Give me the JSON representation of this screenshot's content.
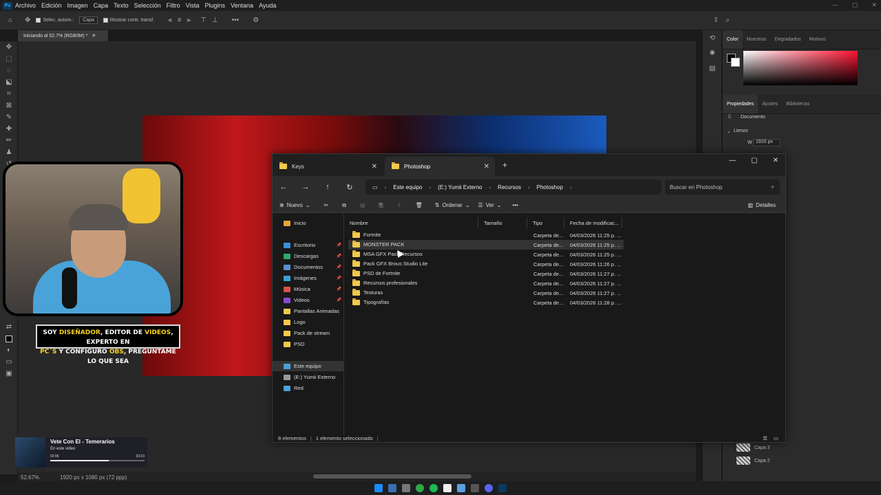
{
  "menubar": {
    "app_icon": "Ps",
    "items": [
      "Archivo",
      "Edición",
      "Imagen",
      "Capa",
      "Texto",
      "Selección",
      "Filtro",
      "Vista",
      "Plugins",
      "Ventana",
      "Ayuda"
    ]
  },
  "options": {
    "auto_select_label": "Selec. autom.:",
    "auto_select_value": "Capa",
    "transform_label": "Mostrar contr. transf."
  },
  "document_tab": {
    "title": "Iniciando al 52.7% (RGB/8#) *"
  },
  "status": {
    "zoom": "52.67%",
    "doc_size": "1920 px x 1080 px (72 ppp)"
  },
  "right_panel": {
    "color_tabs": [
      "Color",
      "Muestras",
      "Degradados",
      "Motivos"
    ],
    "props_tabs": [
      "Propiedades",
      "Ajustes",
      "Bibliotecas"
    ],
    "doc_label": "Documento",
    "canvas_section": "Lienzo",
    "width_value": "1920 px",
    "layers": [
      "Capa 3",
      "Capa 2"
    ]
  },
  "webcam": {
    "caption_parts": [
      "SOY ",
      "DISEÑADOR",
      ", EDITOR DE ",
      "VIDEOS",
      ", EXPERTO EN"
    ],
    "caption_parts2": [
      "PC´S",
      " Y CONFIGURO ",
      "OBS",
      ", PREGUNTAME LO QUE SEA"
    ]
  },
  "video_card": {
    "title": "Vete Con El - Temerarios",
    "subtitle": "En este video",
    "time_current": "02:06",
    "time_total": "03:23",
    "progress": 0.62
  },
  "explorer": {
    "tabs": [
      "Keys",
      "Photoshop"
    ],
    "breadcrumb": [
      "Este equipo",
      "(E:) Yumii Externo",
      "Recursos",
      "Photoshop"
    ],
    "search_placeholder": "Buscar en Photoshop",
    "commands": {
      "new": "Nuevo",
      "sort": "Ordenar",
      "view": "Ver",
      "details": "Detalles"
    },
    "nav": [
      {
        "label": "Inicio",
        "icon": "home-icon",
        "color": "#e8a33a",
        "pinned": false
      },
      {
        "label": "Escritorio",
        "icon": "desktop-icon",
        "color": "#3a8fd8",
        "pinned": true
      },
      {
        "label": "Descargas",
        "icon": "download-icon",
        "color": "#2fa86a",
        "pinned": true
      },
      {
        "label": "Documentos",
        "icon": "document-icon",
        "color": "#5a8fd0",
        "pinned": true
      },
      {
        "label": "Imágenes",
        "icon": "pictures-icon",
        "color": "#3a9fd8",
        "pinned": true
      },
      {
        "label": "Música",
        "icon": "music-icon",
        "color": "#d8534a",
        "pinned": true
      },
      {
        "label": "Videos",
        "icon": "video-icon",
        "color": "#8a4ad0",
        "pinned": true
      },
      {
        "label": "Pantallas Animadas",
        "icon": "folder-icon",
        "color": "#f2c94c",
        "pinned": false
      },
      {
        "label": "Logo",
        "icon": "folder-icon",
        "color": "#f2c94c",
        "pinned": false
      },
      {
        "label": "Pack de stream",
        "icon": "folder-icon",
        "color": "#f2c94c",
        "pinned": false
      },
      {
        "label": "PSD",
        "icon": "folder-icon",
        "color": "#f2c94c",
        "pinned": false
      },
      {
        "label": "Este equipo",
        "icon": "computer-icon",
        "color": "#4aa0d8",
        "pinned": false
      },
      {
        "label": "(E:) Yumii Externo",
        "icon": "drive-icon",
        "color": "#999999",
        "pinned": false
      },
      {
        "label": "Red",
        "icon": "network-icon",
        "color": "#4aa0d8",
        "pinned": false
      }
    ],
    "columns": [
      "Nombre",
      "Tamaño",
      "Tipo",
      "Fecha de modificac..."
    ],
    "rows": [
      {
        "name": "Fortnite",
        "type": "Carpeta de...",
        "date": "04/03/2026 11:25 p. ..."
      },
      {
        "name": "MONSTER PACK",
        "type": "Carpeta de...",
        "date": "04/03/2026 11:25 p. ..."
      },
      {
        "name": "MSA GFX Pack Recursos",
        "type": "Carpeta de...",
        "date": "04/03/2026 11:25 p. ..."
      },
      {
        "name": "Pack GFX Brous Studio Lite",
        "type": "Carpeta de...",
        "date": "04/03/2026 11:26 p. ..."
      },
      {
        "name": "PSD de Fortnite",
        "type": "Carpeta de...",
        "date": "04/03/2026 11:27 p. ..."
      },
      {
        "name": "Recursos profesionales",
        "type": "Carpeta de...",
        "date": "04/03/2026 11:27 p. ..."
      },
      {
        "name": "Texturas",
        "type": "Carpeta de...",
        "date": "04/03/2026 11:27 p. ..."
      },
      {
        "name": "Tipografías",
        "type": "Carpeta de...",
        "date": "04/03/2026 11:28 p. ..."
      }
    ],
    "status_count": "8 elementos",
    "status_selected": "1 elemento seleccionado"
  }
}
